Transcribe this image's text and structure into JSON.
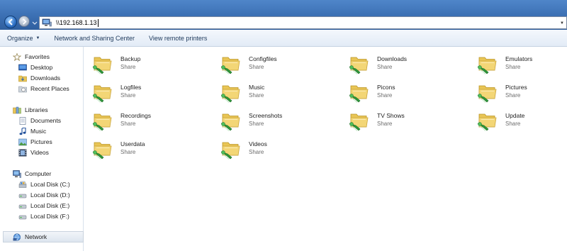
{
  "address_bar": {
    "path": "\\\\192.168.1.13"
  },
  "toolbar": {
    "organize": "Organize",
    "network_and_sharing": "Network and Sharing Center",
    "view_remote_printers": "View remote printers"
  },
  "navigation": {
    "favorites": {
      "label": "Favorites",
      "items": [
        "Desktop",
        "Downloads",
        "Recent Places"
      ]
    },
    "libraries": {
      "label": "Libraries",
      "items": [
        "Documents",
        "Music",
        "Pictures",
        "Videos"
      ]
    },
    "computer": {
      "label": "Computer",
      "items": [
        "Local Disk (C:)",
        "Local Disk (D:)",
        "Local Disk (E:)",
        "Local Disk (F:)"
      ]
    },
    "network": {
      "label": "Network",
      "selected": true
    }
  },
  "shares": [
    {
      "name": "Backup",
      "type": "Share"
    },
    {
      "name": "Configfiles",
      "type": "Share"
    },
    {
      "name": "Downloads",
      "type": "Share"
    },
    {
      "name": "Emulators",
      "type": "Share"
    },
    {
      "name": "Logfiles",
      "type": "Share"
    },
    {
      "name": "Music",
      "type": "Share"
    },
    {
      "name": "Picons",
      "type": "Share"
    },
    {
      "name": "Pictures",
      "type": "Share"
    },
    {
      "name": "Recordings",
      "type": "Share"
    },
    {
      "name": "Screenshots",
      "type": "Share"
    },
    {
      "name": "TV Shows",
      "type": "Share"
    },
    {
      "name": "Update",
      "type": "Share"
    },
    {
      "name": "Userdata",
      "type": "Share"
    },
    {
      "name": "Videos",
      "type": "Share"
    }
  ],
  "colors": {
    "title_bar": "#3b6fb3",
    "toolbar_text": "#1e395b",
    "folder": "#f3d676",
    "share_arrow": "#2e9a3a",
    "subtext": "#6d6d6d"
  },
  "icons": {
    "back": "back-arrow-icon",
    "forward": "forward-arrow-icon",
    "address": "network-computer-icon",
    "favorites": "star-icon",
    "desktop": "desktop-icon",
    "downloads": "downloads-folder-icon",
    "recent_places": "recent-places-icon",
    "libraries": "library-icon",
    "documents": "documents-icon",
    "music": "music-note-icon",
    "pictures": "pictures-icon",
    "videos": "film-icon",
    "computer": "computer-icon",
    "disk": "hard-disk-icon",
    "network": "network-icon",
    "share": "shared-folder-icon"
  }
}
